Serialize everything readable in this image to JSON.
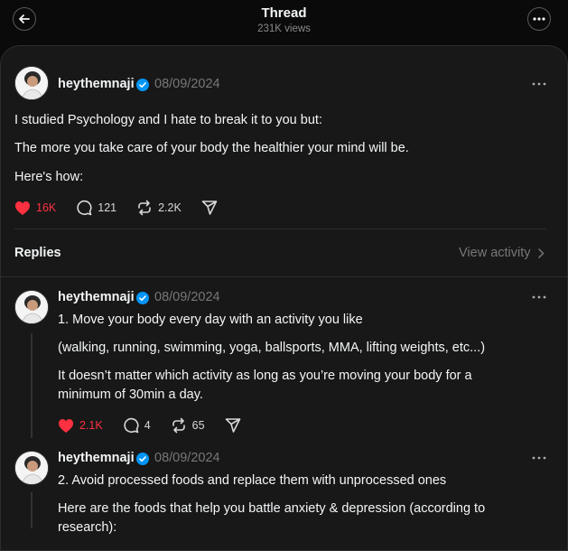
{
  "header": {
    "title": "Thread",
    "views": "231K views",
    "back_icon": "arrow-left-icon",
    "more_icon": "more-horizontal-icon"
  },
  "post": {
    "username": "heythemnaji",
    "date": "08/09/2024",
    "lines": [
      "I studied Psychology and I hate to break it to you but:",
      "The more you take care of your body the healthier your mind will be.",
      "Here's how:"
    ],
    "likes": "16K",
    "comments": "121",
    "reposts": "2.2K",
    "liked": true
  },
  "replies_section": {
    "label": "Replies",
    "view_activity": "View activity"
  },
  "replies": [
    {
      "username": "heythemnaji",
      "date": "08/09/2024",
      "lines": [
        "1. Move your body every day with an activity you like",
        "(walking, running, swimming, yoga, ballsports, MMA, lifting weights, etc...)",
        "It doesn’t matter which activity as long as you’re moving your body for a",
        "minimum of 30min a day."
      ],
      "likes": "2.1K",
      "comments": "4",
      "reposts": "65",
      "liked": true
    },
    {
      "username": "heythemnaji",
      "date": "08/09/2024",
      "lines": [
        "2. Avoid processed foods and replace them with unprocessed ones",
        "Here are the foods that help you battle anxiety & depression (according to",
        "research):"
      ]
    }
  ],
  "colors": {
    "background": "#0a0a0a",
    "panel": "#181818",
    "like": "#ff3040",
    "verified": "#0095f6",
    "muted": "#777777"
  }
}
